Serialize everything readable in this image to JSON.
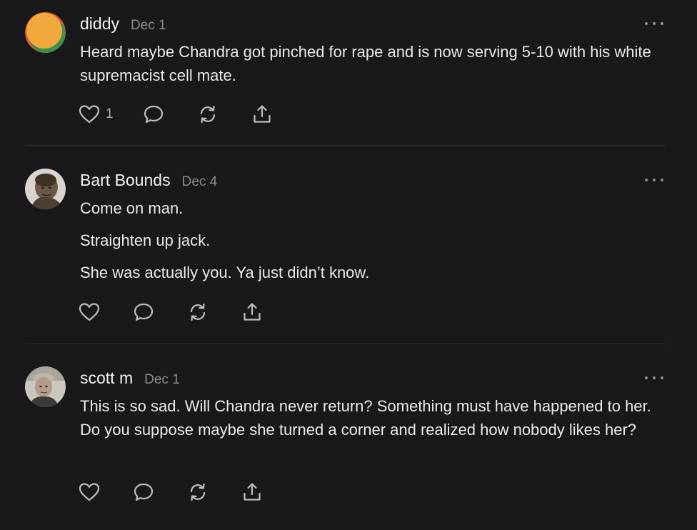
{
  "comments": [
    {
      "author": "diddy",
      "date": "Dec 1",
      "paragraphs": [
        "Heard maybe Chandra got pinched for rape and is now serving 5-10 with his white supremacist cell mate."
      ],
      "like_count": "1",
      "avatar_colors": [
        "#f2a93b",
        "#3f8f4e",
        "#e0573c"
      ]
    },
    {
      "author": "Bart Bounds",
      "date": "Dec 4",
      "paragraphs": [
        "Come on man.",
        "Straighten up jack.",
        "She was actually you. Ya just didn’t know."
      ],
      "like_count": "",
      "avatar_colors": [
        "#d9d4cc",
        "#5a4a3c",
        "#8b7a68"
      ]
    },
    {
      "author": "scott m",
      "date": "Dec 1",
      "paragraphs": [
        "This is so sad. Will Chandra never return? Something must have happened to her. Do you suppose maybe she turned a corner and realized how nobody likes her?"
      ],
      "like_count": "",
      "avatar_colors": [
        "#c9c7be",
        "#3a3a3a",
        "#b59a8a"
      ]
    }
  ],
  "icons": {
    "like": "heart-icon",
    "reply": "comment-bubble-icon",
    "restack": "restack-icon",
    "share": "share-icon",
    "more": "more-horizontal-icon"
  },
  "colors": {
    "background": "#19191b",
    "text": "#e9e9ea",
    "muted": "#8b8b8e",
    "divider": "#2f2f32"
  }
}
